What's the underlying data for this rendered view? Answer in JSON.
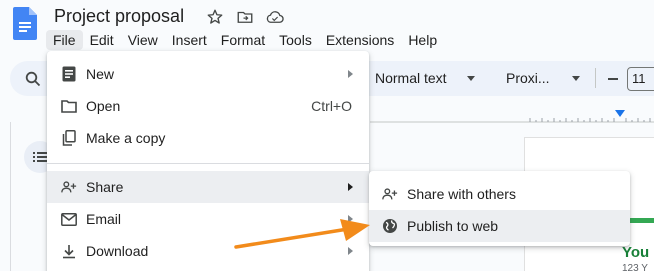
{
  "app": {
    "title": "Project proposal"
  },
  "title_icons": [
    "star-icon",
    "move-to-folder-icon",
    "cloud-saved-icon"
  ],
  "menubar": {
    "items": [
      "File",
      "Edit",
      "View",
      "Insert",
      "Format",
      "Tools",
      "Extensions",
      "Help"
    ],
    "active": "File"
  },
  "toolbar": {
    "paragraph_style": "Normal text",
    "font": "Proxi...",
    "font_size": "11"
  },
  "file_menu": {
    "items": [
      {
        "label": "New",
        "icon": "document-icon",
        "has_submenu": true
      },
      {
        "label": "Open",
        "icon": "folder-icon",
        "shortcut": "Ctrl+O"
      },
      {
        "label": "Make a copy",
        "icon": "copy-icon"
      },
      {
        "label": "Share",
        "icon": "person-add-icon",
        "has_submenu": true,
        "highlighted": true
      },
      {
        "label": "Email",
        "icon": "mail-icon",
        "has_submenu": true
      },
      {
        "label": "Download",
        "icon": "download-icon",
        "has_submenu": true
      }
    ]
  },
  "share_submenu": {
    "items": [
      {
        "label": "Share with others",
        "icon": "person-add-icon"
      },
      {
        "label": "Publish to web",
        "icon": "globe-icon",
        "highlighted": true
      }
    ]
  },
  "document": {
    "visible_text": "You",
    "sub_text": "123 Y"
  },
  "colors": {
    "accent": "#1a73e8",
    "annotation_arrow": "#f28b1b",
    "doc_green": "#188038",
    "highlight": "#eceef1"
  }
}
